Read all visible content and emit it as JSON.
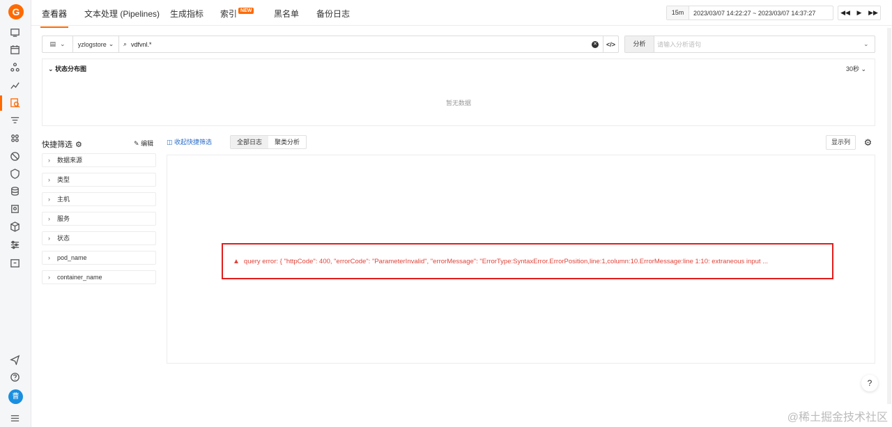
{
  "sidebar": {
    "logo": "G",
    "avatar_text": "曹"
  },
  "nav": {
    "tabs": [
      {
        "label": "查看器"
      },
      {
        "label": "文本处理 (Pipelines)"
      },
      {
        "label": "生成指标"
      },
      {
        "label": "索引"
      },
      {
        "label": "黑名单"
      },
      {
        "label": "备份日志"
      }
    ],
    "new_badge": "NEW"
  },
  "time": {
    "quick": "15m",
    "range": "2023/03/07 14:22:27 ~ 2023/03/07 14:37:27",
    "ctrls": [
      "◀◀",
      "▶",
      "▶▶"
    ]
  },
  "query": {
    "store": "yzlogstore",
    "search_value": "vdfvnl.*",
    "code_symbol": "</>"
  },
  "analysis": {
    "label": "分析",
    "placeholder": "请输入分析语句"
  },
  "distribution": {
    "title": "状态分布图",
    "interval": "30秒",
    "empty_text": "暂无数据"
  },
  "quick_filter": {
    "title": "快捷筛选",
    "edit_label": "编辑",
    "items": [
      "数据来源",
      "类型",
      "主机",
      "服务",
      "状态",
      "pod_name",
      "container_name"
    ]
  },
  "results": {
    "collapse_label": "收起快捷筛选",
    "view_tabs": [
      "全部日志",
      "聚类分析"
    ],
    "columns_label": "显示列",
    "error_text": "query error: { \"httpCode\": 400, \"errorCode\": \"ParameterInvalid\", \"errorMessage\": \"ErrorType:SyntaxError.ErrorPosition,line:1,column:10.ErrorMessage:line 1:10: extraneous input ..."
  },
  "help_symbol": "?",
  "watermark": "@稀土掘金技术社区"
}
